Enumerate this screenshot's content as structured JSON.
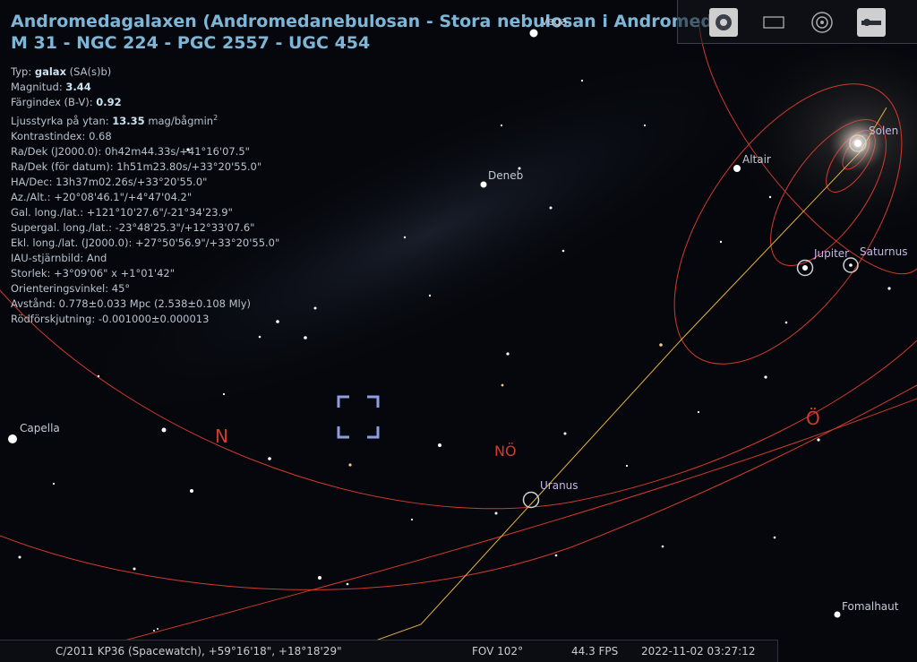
{
  "header": {
    "title_line1": "Andromedagalaxen (Andromedanebulosan - Stora nebulosan i Andromeda)",
    "title_line2": "M 31 - NGC 224 - PGC 2557 - UGC 454"
  },
  "info": {
    "type_label": "Typ:",
    "type_value": "galax",
    "type_suffix": "(SA(s)b)",
    "mag_label": "Magnitud:",
    "mag_value": "3.44",
    "color_label": "Färgindex (B-V):",
    "color_value": "0.92",
    "surface_label": "Ljusstyrka på ytan:",
    "surface_value": "13.35",
    "surface_unit": "mag/bågmin",
    "surface_sup": "2",
    "contrast": "Kontrastindex: 0.68",
    "radec_j2000": "Ra/Dek (J2000.0): 0h42m44.33s/+41°16'07.5\"",
    "radec_date": "Ra/Dek (för datum): 1h51m23.80s/+33°20'55.0\"",
    "hadec": "HA/Dec: 13h37m02.26s/+33°20'55.0\"",
    "azalt": "Az./Alt.: +20°08'46.1\"/+4°47'04.2\"",
    "gal": "Gal. long./lat.: +121°10'27.6\"/-21°34'23.9\"",
    "supergal": "Supergal. long./lat.: -23°48'25.3\"/+12°33'07.6\"",
    "ekl": "Ekl. long./lat. (J2000.0): +27°50'56.9\"/+33°20'55.0\"",
    "iau": "IAU-stjärnbild: And",
    "size": "Storlek: +3°09'06\" x +1°01'42\"",
    "orient": "Orienteringsvinkel: 45°",
    "distance": "Avstånd: 0.778±0.033 Mpc (2.538±0.108 Mly)",
    "redshift": "Rödförskjutning: -0.001000±0.000013"
  },
  "labels": {
    "vega": "Vega",
    "deneb": "Deneb",
    "altair": "Altair",
    "capella": "Capella",
    "fomalhaut": "Fomalhaut",
    "solen": "Solen",
    "jupiter": "Jupiter",
    "saturnus": "Saturnus",
    "uranus": "Uranus"
  },
  "cardinals": {
    "north": "N",
    "northeast": "NÖ",
    "east": "Ö"
  },
  "bottom_bar": {
    "location": "C/2011 KP36 (Spacewatch), +59°16'18\", +18°18'29\"",
    "fov": "FOV 102°",
    "fps": "44.3 FPS",
    "datetime": "2022-11-02 03:27:12"
  },
  "colors": {
    "title": "#7db6d6",
    "orbit_red": "#d23a2d",
    "ecliptic_yellow": "#e6b43a",
    "selection_marker": "#8e9fe0"
  }
}
